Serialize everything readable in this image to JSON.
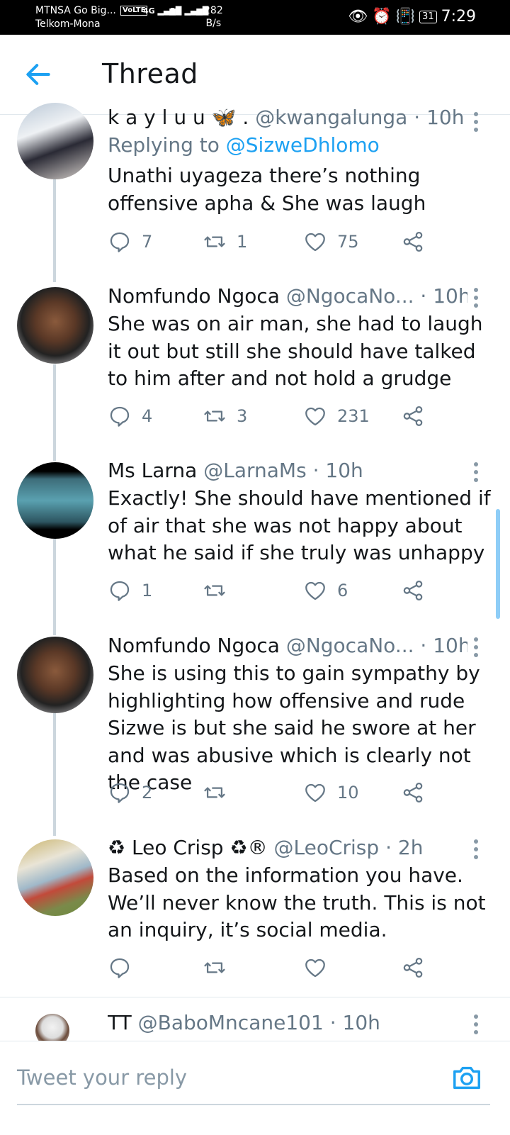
{
  "status_bar": {
    "carrier1": "MTNSA Go Big...",
    "carrier2": "Telkom-Mona",
    "volte": "VoLTE",
    "net1": "4G",
    "net2": "3G",
    "speed_value": "282",
    "speed_unit": "B/s",
    "battery": "31",
    "time": "7:29"
  },
  "header": {
    "title": "Thread",
    "back_icon": "arrow-left-icon"
  },
  "tweets": [
    {
      "name": "k a y l u u 🦋 .",
      "handle": "@kwangalunga",
      "time": "10h",
      "replying_label": "Replying to",
      "replying_mention": "@SizweDhlomo",
      "text": "Unathi uyageza there’s nothing offensive apha & She was laugh",
      "replies": "7",
      "retweets": "1",
      "likes": "75"
    },
    {
      "name": "Nomfundo Ngoca",
      "handle": "@NgocaNo...",
      "time": "10h",
      "text": "She was on air man, she had to laugh it out but still she should have talked to him after and not hold a grudge",
      "replies": "4",
      "retweets": "3",
      "likes": "231"
    },
    {
      "name": "Ms Larna",
      "handle": "@LarnaMs",
      "time": "10h",
      "text": "Exactly! She should have mentioned if of air that she was not happy about what he said if she truly was unhappy",
      "replies": "1",
      "retweets": "",
      "likes": "6"
    },
    {
      "name": "Nomfundo Ngoca",
      "handle": "@NgocaNo...",
      "time": "10h",
      "text": "She is using this to gain sympathy by highlighting   how offensive and rude Sizwe is but she said he swore at her and was abusive which  is clearly not the case",
      "replies": "2",
      "retweets": "",
      "likes": "10"
    },
    {
      "name": "♻ Leo Crisp ♻®",
      "handle": "@LeoCrisp",
      "time": "2h",
      "text": "Based on the information you have. We’ll never know the truth. This is not an inquiry, it’s social media.",
      "replies": "",
      "retweets": "",
      "likes": ""
    },
    {
      "name": "TT",
      "handle": "@BaboMncane101",
      "time": "10h"
    }
  ],
  "separator": "·",
  "compose": {
    "placeholder": "Tweet your reply",
    "camera_icon": "camera-icon"
  }
}
